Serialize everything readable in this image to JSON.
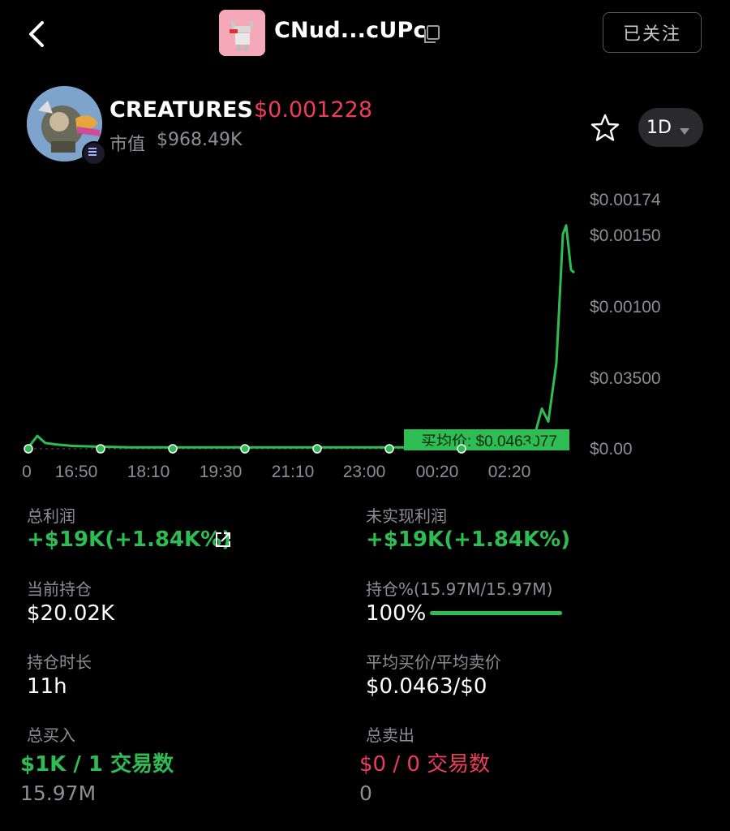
{
  "header": {
    "address": "CNud...cUPc",
    "follow_label": "已关注"
  },
  "token": {
    "name": "CREATURES",
    "price": "$0.001228",
    "mcap_label": "市值",
    "mcap_value": "$968.49K",
    "timeframe": "1D"
  },
  "colors": {
    "green": "#2ebd52",
    "red": "#ee3d5a",
    "muted": "#8e8e93"
  },
  "chart_data": {
    "type": "line",
    "y_ticks": [
      "$0.00174",
      "$0.00150",
      "$0.00100",
      "$0.03500",
      "$0.00"
    ],
    "x_ticks": [
      "0",
      "16:50",
      "18:10",
      "19:30",
      "21:10",
      "23:00",
      "00:20",
      "02:20"
    ],
    "avg_buy_label": "买均价: $0.0463077",
    "series": [
      {
        "values": [
          1e-05,
          9e-05,
          4e-05,
          3e-05,
          2e-05,
          1.5e-05,
          1e-05,
          1e-05,
          1e-05,
          1e-05,
          1e-05,
          1e-05,
          1e-05,
          1e-05,
          1e-05,
          1e-05,
          1e-05,
          1e-05,
          1e-05,
          1e-05,
          1e-05,
          1e-05,
          3e-05,
          0.00028,
          0.00019,
          0.0006,
          0.0015,
          0.00156,
          0.00125,
          0.00123
        ]
      }
    ]
  },
  "stats": {
    "total_pnl_label": "总利润",
    "total_pnl_value": "+$19K(+1.84K%)",
    "unrealized_label": "未实现利润",
    "unrealized_value": "+$19K(+1.84K%)",
    "position_label": "当前持仓",
    "position_value": "$20.02K",
    "hold_pct_label": "持仓%(15.97M/15.97M)",
    "hold_pct_value": "100%",
    "hold_pct": 1.0,
    "hold_time_label": "持仓时长",
    "hold_time_value": "11h",
    "avg_price_label": "平均买价/平均卖价",
    "avg_price_value": "$0.0463/$0",
    "total_buy_label": "总买入",
    "total_buy_value": "$1K / 1 交易数",
    "total_buy_amount": "15.97M",
    "total_sell_label": "总卖出",
    "total_sell_value": "$0 / 0 交易数",
    "total_sell_amount": "0"
  }
}
